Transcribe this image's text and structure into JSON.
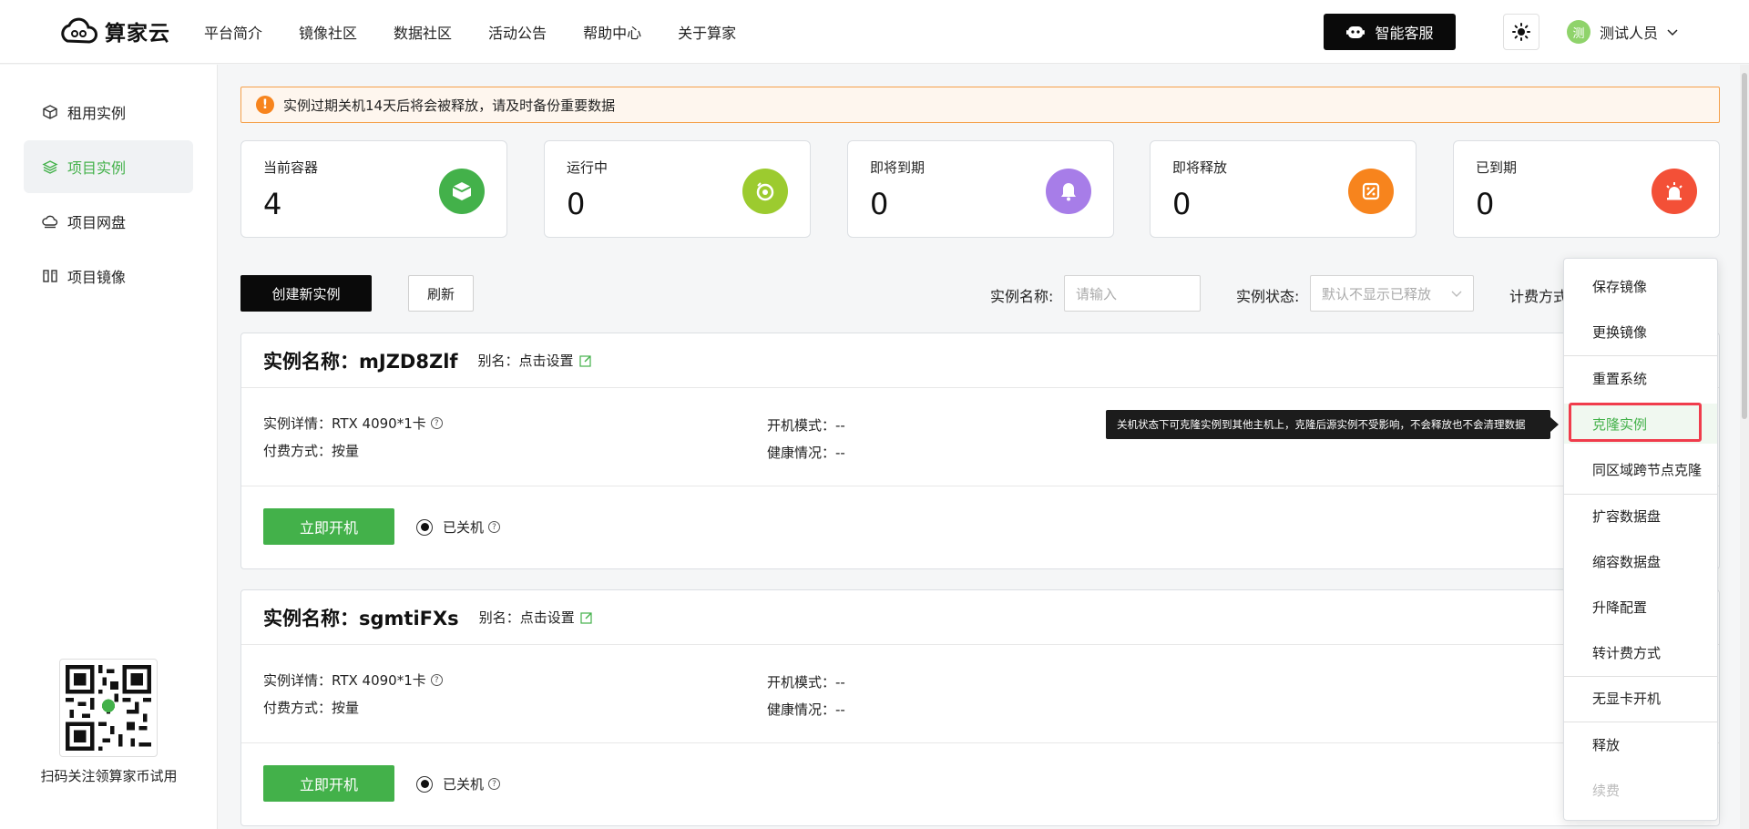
{
  "header": {
    "brand": "算家云",
    "nav": [
      "平台简介",
      "镜像社区",
      "数据社区",
      "活动公告",
      "帮助中心",
      "关于算家"
    ],
    "service_button": "智能客服",
    "user": {
      "avatar_char": "测",
      "name": "测试人员"
    }
  },
  "sidebar": {
    "items": [
      {
        "label": "租用实例",
        "icon": "cube-icon"
      },
      {
        "label": "项目实例",
        "icon": "layers-icon",
        "active": true
      },
      {
        "label": "项目网盘",
        "icon": "cloud-disk-icon"
      },
      {
        "label": "项目镜像",
        "icon": "image-icon"
      }
    ],
    "qr_caption": "扫码关注领算家币试用"
  },
  "notice": "实例过期关机14天后将会被释放，请及时备份重要数据",
  "stats": [
    {
      "label": "当前容器",
      "value": "4",
      "color": "#43b14a"
    },
    {
      "label": "运行中",
      "value": "0",
      "color": "#9ccb2f"
    },
    {
      "label": "即将到期",
      "value": "0",
      "color": "#a77de8"
    },
    {
      "label": "即将释放",
      "value": "0",
      "color": "#f7841d"
    },
    {
      "label": "已到期",
      "value": "0",
      "color": "#f35037"
    }
  ],
  "toolbar": {
    "create": "创建新实例",
    "refresh": "刷新",
    "name_label": "实例名称:",
    "name_placeholder": "请输入",
    "status_label": "实例状态:",
    "status_placeholder": "默认不显示已释放",
    "billing_label": "计费方式"
  },
  "instances": [
    {
      "title": "实例名称：mJZD8Zlf",
      "alias": "别名：点击设置",
      "detail_label": "实例详情：",
      "detail_value": "RTX 4090*1卡",
      "pay_label": "付费方式：",
      "pay_value": "按量",
      "boot_label": "开机模式：",
      "boot_value": "--",
      "health_label": "健康情况：",
      "health_value": "--",
      "start_button": "立即开机",
      "status": "已关机"
    },
    {
      "title": "实例名称：sgmtiFXs",
      "alias": "别名：点击设置",
      "detail_label": "实例详情：",
      "detail_value": "RTX 4090*1卡",
      "pay_label": "付费方式：",
      "pay_value": "按量",
      "boot_label": "开机模式：",
      "boot_value": "--",
      "health_label": "健康情况：",
      "health_value": "--",
      "start_button": "立即开机",
      "status": "已关机"
    }
  ],
  "menu": {
    "items": [
      "保存镜像",
      "更换镜像",
      "重置系统",
      "克隆实例",
      "同区域跨节点克隆",
      "扩容数据盘",
      "缩容数据盘",
      "升降配置",
      "转计费方式",
      "无显卡开机",
      "释放",
      "续费"
    ],
    "highlighted": "克隆实例",
    "disabled": "续费"
  },
  "tooltip": "关机状态下可克隆实例到其他主机上，克隆后源实例不受影响，不会释放也不会清理数据",
  "colors": {
    "accent": "#43b14a",
    "highlight_border": "#f03c4c"
  }
}
